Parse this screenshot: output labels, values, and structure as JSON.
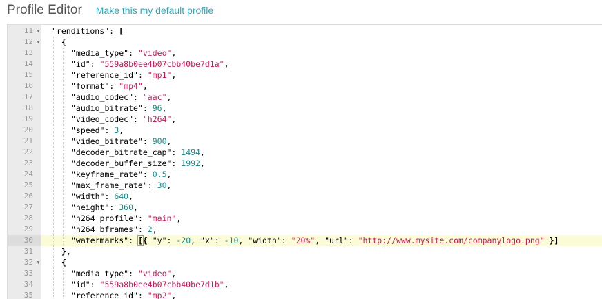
{
  "header": {
    "title": "Profile Editor",
    "default_link": "Make this my default profile"
  },
  "editor": {
    "active_line": 30,
    "lines": [
      {
        "num": "11",
        "fold": true,
        "indent": 0,
        "tokens": [
          {
            "t": "\"renditions\"",
            "c": "k"
          },
          {
            "t": ": ",
            "c": "p"
          },
          {
            "t": "[",
            "c": "p b"
          }
        ]
      },
      {
        "num": "12",
        "fold": true,
        "indent": 1,
        "tokens": [
          {
            "t": "{",
            "c": "p b"
          }
        ]
      },
      {
        "num": "13",
        "fold": false,
        "indent": 2,
        "tokens": [
          {
            "t": "\"media_type\"",
            "c": "k"
          },
          {
            "t": ": ",
            "c": "p"
          },
          {
            "t": "\"video\"",
            "c": "s"
          },
          {
            "t": ",",
            "c": "p"
          }
        ]
      },
      {
        "num": "14",
        "fold": false,
        "indent": 2,
        "tokens": [
          {
            "t": "\"id\"",
            "c": "k"
          },
          {
            "t": ": ",
            "c": "p"
          },
          {
            "t": "\"559a8b0ee4b07cbb40be7d1a\"",
            "c": "s"
          },
          {
            "t": ",",
            "c": "p"
          }
        ]
      },
      {
        "num": "15",
        "fold": false,
        "indent": 2,
        "tokens": [
          {
            "t": "\"reference_id\"",
            "c": "k"
          },
          {
            "t": ": ",
            "c": "p"
          },
          {
            "t": "\"mp1\"",
            "c": "s"
          },
          {
            "t": ",",
            "c": "p"
          }
        ]
      },
      {
        "num": "16",
        "fold": false,
        "indent": 2,
        "tokens": [
          {
            "t": "\"format\"",
            "c": "k"
          },
          {
            "t": ": ",
            "c": "p"
          },
          {
            "t": "\"mp4\"",
            "c": "s"
          },
          {
            "t": ",",
            "c": "p"
          }
        ]
      },
      {
        "num": "17",
        "fold": false,
        "indent": 2,
        "tokens": [
          {
            "t": "\"audio_codec\"",
            "c": "k"
          },
          {
            "t": ": ",
            "c": "p"
          },
          {
            "t": "\"aac\"",
            "c": "s"
          },
          {
            "t": ",",
            "c": "p"
          }
        ]
      },
      {
        "num": "18",
        "fold": false,
        "indent": 2,
        "tokens": [
          {
            "t": "\"audio_bitrate\"",
            "c": "k"
          },
          {
            "t": ": ",
            "c": "p"
          },
          {
            "t": "96",
            "c": "n"
          },
          {
            "t": ",",
            "c": "p"
          }
        ]
      },
      {
        "num": "19",
        "fold": false,
        "indent": 2,
        "tokens": [
          {
            "t": "\"video_codec\"",
            "c": "k"
          },
          {
            "t": ": ",
            "c": "p"
          },
          {
            "t": "\"h264\"",
            "c": "s"
          },
          {
            "t": ",",
            "c": "p"
          }
        ]
      },
      {
        "num": "20",
        "fold": false,
        "indent": 2,
        "tokens": [
          {
            "t": "\"speed\"",
            "c": "k"
          },
          {
            "t": ": ",
            "c": "p"
          },
          {
            "t": "3",
            "c": "n"
          },
          {
            "t": ",",
            "c": "p"
          }
        ]
      },
      {
        "num": "21",
        "fold": false,
        "indent": 2,
        "tokens": [
          {
            "t": "\"video_bitrate\"",
            "c": "k"
          },
          {
            "t": ": ",
            "c": "p"
          },
          {
            "t": "900",
            "c": "n"
          },
          {
            "t": ",",
            "c": "p"
          }
        ]
      },
      {
        "num": "22",
        "fold": false,
        "indent": 2,
        "tokens": [
          {
            "t": "\"decoder_bitrate_cap\"",
            "c": "k"
          },
          {
            "t": ": ",
            "c": "p"
          },
          {
            "t": "1494",
            "c": "n"
          },
          {
            "t": ",",
            "c": "p"
          }
        ]
      },
      {
        "num": "23",
        "fold": false,
        "indent": 2,
        "tokens": [
          {
            "t": "\"decoder_buffer_size\"",
            "c": "k"
          },
          {
            "t": ": ",
            "c": "p"
          },
          {
            "t": "1992",
            "c": "n"
          },
          {
            "t": ",",
            "c": "p"
          }
        ]
      },
      {
        "num": "24",
        "fold": false,
        "indent": 2,
        "tokens": [
          {
            "t": "\"keyframe_rate\"",
            "c": "k"
          },
          {
            "t": ": ",
            "c": "p"
          },
          {
            "t": "0.5",
            "c": "n"
          },
          {
            "t": ",",
            "c": "p"
          }
        ]
      },
      {
        "num": "25",
        "fold": false,
        "indent": 2,
        "tokens": [
          {
            "t": "\"max_frame_rate\"",
            "c": "k"
          },
          {
            "t": ": ",
            "c": "p"
          },
          {
            "t": "30",
            "c": "n"
          },
          {
            "t": ",",
            "c": "p"
          }
        ]
      },
      {
        "num": "26",
        "fold": false,
        "indent": 2,
        "tokens": [
          {
            "t": "\"width\"",
            "c": "k"
          },
          {
            "t": ": ",
            "c": "p"
          },
          {
            "t": "640",
            "c": "n"
          },
          {
            "t": ",",
            "c": "p"
          }
        ]
      },
      {
        "num": "27",
        "fold": false,
        "indent": 2,
        "tokens": [
          {
            "t": "\"height\"",
            "c": "k"
          },
          {
            "t": ": ",
            "c": "p"
          },
          {
            "t": "360",
            "c": "n"
          },
          {
            "t": ",",
            "c": "p"
          }
        ]
      },
      {
        "num": "28",
        "fold": false,
        "indent": 2,
        "tokens": [
          {
            "t": "\"h264_profile\"",
            "c": "k"
          },
          {
            "t": ": ",
            "c": "p"
          },
          {
            "t": "\"main\"",
            "c": "s"
          },
          {
            "t": ",",
            "c": "p"
          }
        ]
      },
      {
        "num": "29",
        "fold": false,
        "indent": 2,
        "tokens": [
          {
            "t": "\"h264_bframes\"",
            "c": "k"
          },
          {
            "t": ": ",
            "c": "p"
          },
          {
            "t": "2",
            "c": "n"
          },
          {
            "t": ",",
            "c": "p"
          }
        ]
      },
      {
        "num": "30",
        "fold": false,
        "indent": 2,
        "tokens": [
          {
            "t": "\"watermarks\"",
            "c": "k"
          },
          {
            "t": ": ",
            "c": "p"
          },
          {
            "t": "[",
            "c": "p b cursor-box"
          },
          {
            "t": "{ ",
            "c": "p b"
          },
          {
            "t": "\"y\"",
            "c": "k"
          },
          {
            "t": ": ",
            "c": "p"
          },
          {
            "t": "-20",
            "c": "n"
          },
          {
            "t": ", ",
            "c": "p"
          },
          {
            "t": "\"x\"",
            "c": "k"
          },
          {
            "t": ": ",
            "c": "p"
          },
          {
            "t": "-10",
            "c": "n"
          },
          {
            "t": ", ",
            "c": "p"
          },
          {
            "t": "\"width\"",
            "c": "k"
          },
          {
            "t": ": ",
            "c": "p"
          },
          {
            "t": "\"20%\"",
            "c": "s"
          },
          {
            "t": ", ",
            "c": "p"
          },
          {
            "t": "\"url\"",
            "c": "k"
          },
          {
            "t": ": ",
            "c": "p"
          },
          {
            "t": "\"http://www.mysite.com/companylogo.png\"",
            "c": "s"
          },
          {
            "t": " }]",
            "c": "p b"
          }
        ]
      },
      {
        "num": "31",
        "fold": false,
        "indent": 1,
        "tokens": [
          {
            "t": "}",
            "c": "p b"
          },
          {
            "t": ",",
            "c": "p"
          }
        ]
      },
      {
        "num": "32",
        "fold": true,
        "indent": 1,
        "tokens": [
          {
            "t": "{",
            "c": "p b"
          }
        ]
      },
      {
        "num": "33",
        "fold": false,
        "indent": 2,
        "tokens": [
          {
            "t": "\"media_type\"",
            "c": "k"
          },
          {
            "t": ": ",
            "c": "p"
          },
          {
            "t": "\"video\"",
            "c": "s"
          },
          {
            "t": ",",
            "c": "p"
          }
        ]
      },
      {
        "num": "34",
        "fold": false,
        "indent": 2,
        "tokens": [
          {
            "t": "\"id\"",
            "c": "k"
          },
          {
            "t": ": ",
            "c": "p"
          },
          {
            "t": "\"559a8b0ee4b07cbb40be7d1b\"",
            "c": "s"
          },
          {
            "t": ",",
            "c": "p"
          }
        ]
      },
      {
        "num": "35",
        "fold": false,
        "indent": 2,
        "tokens": [
          {
            "t": "\"reference_id\"",
            "c": "k"
          },
          {
            "t": ": ",
            "c": "p"
          },
          {
            "t": "\"mp2\"",
            "c": "s"
          },
          {
            "t": ",",
            "c": "p"
          }
        ]
      }
    ]
  }
}
